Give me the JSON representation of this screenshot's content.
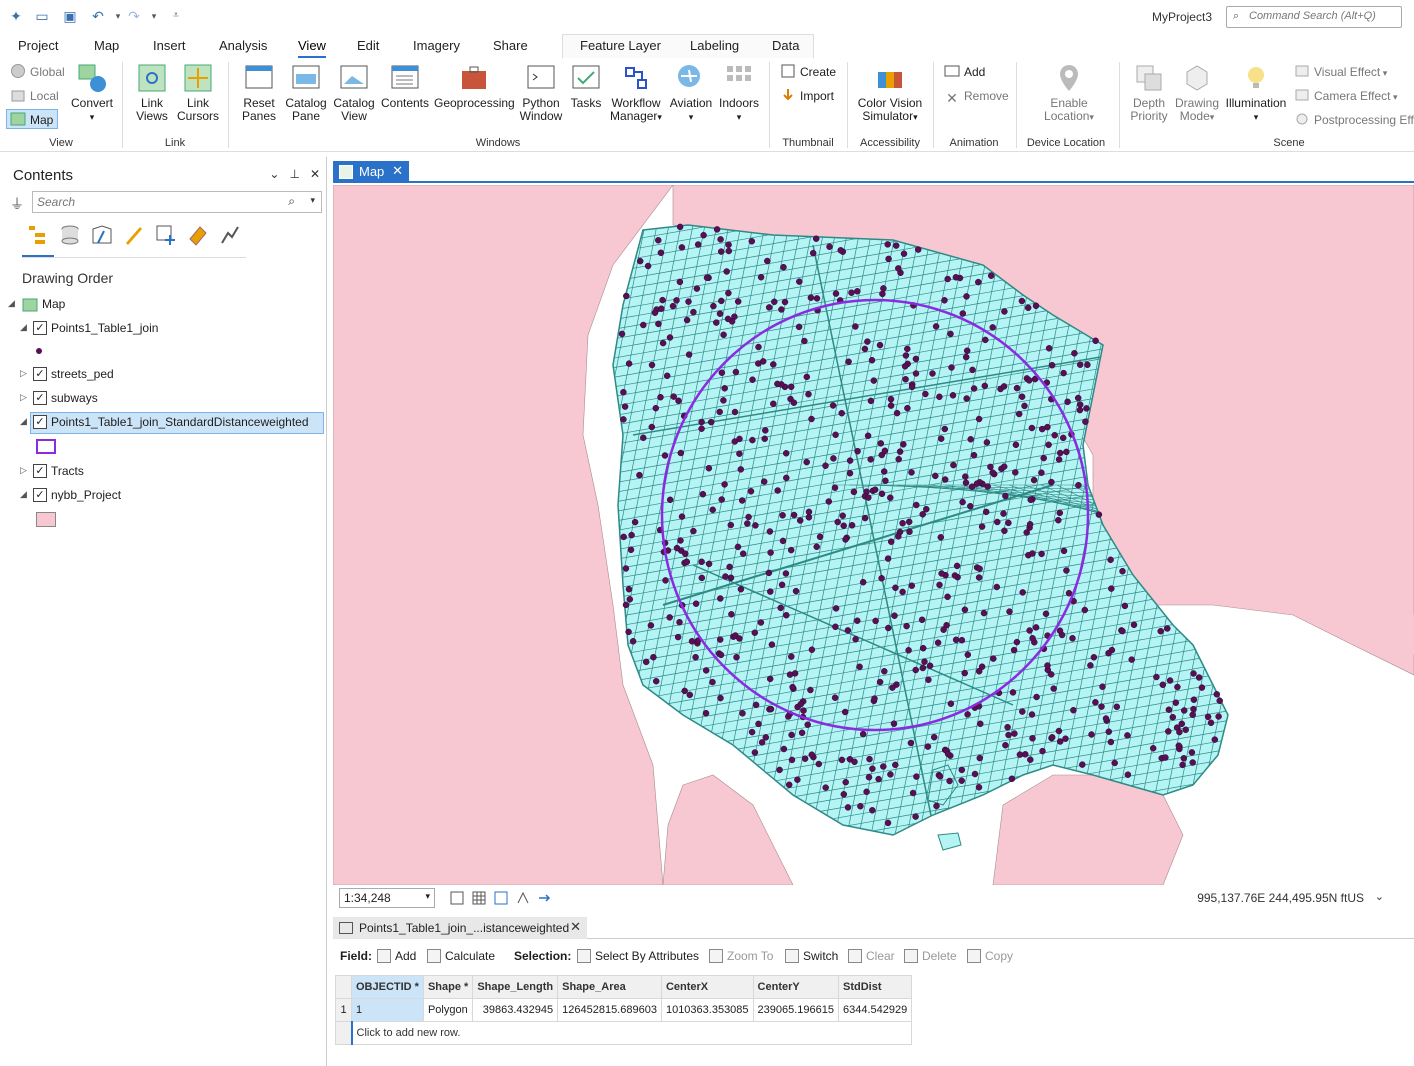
{
  "window": {
    "project_name": "MyProject3",
    "command_search_placeholder": "Command Search (Alt+Q)"
  },
  "ribbon_tabs": [
    "Project",
    "Map",
    "Insert",
    "Analysis",
    "View",
    "Edit",
    "Imagery",
    "Share"
  ],
  "active_tab": "View",
  "context_tabs": [
    "Feature Layer",
    "Labeling",
    "Data"
  ],
  "ribbon": {
    "view_group": {
      "label": "View",
      "global": "Global",
      "local": "Local",
      "map": "Map",
      "convert": "Convert"
    },
    "link_group": {
      "label": "Link",
      "link_views": "Link Views",
      "link_cursors": "Link Cursors"
    },
    "windows_group": {
      "label": "Windows",
      "buttons": [
        "Reset Panes",
        "Catalog Pane",
        "Catalog View",
        "Contents",
        "Geoprocessing",
        "Python Window",
        "Tasks",
        "Workflow Manager",
        "Aviation",
        "Indoors"
      ]
    },
    "thumbnail_group": {
      "label": "Thumbnail",
      "create": "Create",
      "import": "Import"
    },
    "accessibility_group": {
      "label": "Accessibility",
      "button": "Color Vision Simulator"
    },
    "animation_group": {
      "label": "Animation",
      "add": "Add",
      "remove": "Remove"
    },
    "device_location_group": {
      "label": "Device Location",
      "button": "Enable Location"
    },
    "scene_group": {
      "label": "Scene",
      "depth_priority": "Depth Priority",
      "drawing_mode": "Drawing Mode",
      "illumination": "Illumination",
      "visual_effect": "Visual Effect",
      "camera_effect": "Camera Effect",
      "postprocessing": "Postprocessing Effe"
    }
  },
  "contents": {
    "title": "Contents",
    "search_placeholder": "Search",
    "section": "Drawing Order",
    "layers": [
      {
        "name": "Map",
        "checked": false
      },
      {
        "name": "Points1_Table1_join",
        "checked": true
      },
      {
        "name": "streets_ped",
        "checked": true
      },
      {
        "name": "subways",
        "checked": true
      },
      {
        "name": "Points1_Table1_join_StandardDistanceweighted",
        "checked": true,
        "selected": true
      },
      {
        "name": "Tracts",
        "checked": true
      },
      {
        "name": "nybb_Project",
        "checked": true
      }
    ]
  },
  "map_view": {
    "tab_label": "Map",
    "scale": "1:34,248",
    "coordinates": "995,137.76E 244,495.95N ftUS",
    "colors": {
      "land_outside": "#f8c8d2",
      "borough_fill": "#b4f4f4",
      "streets": "#2e8a86",
      "points": "#5a0e57",
      "standard_distance_circle": "#8a2be2"
    }
  },
  "attribute_table": {
    "tab_label": "Points1_Table1_join_...istanceweighted",
    "toolbar": {
      "field_label": "Field:",
      "add": "Add",
      "calculate": "Calculate",
      "selection_label": "Selection:",
      "select_by_attributes": "Select By Attributes",
      "zoom_to": "Zoom To",
      "switch": "Switch",
      "clear": "Clear",
      "delete": "Delete",
      "copy": "Copy"
    },
    "columns": [
      "OBJECTID *",
      "Shape *",
      "Shape_Length",
      "Shape_Area",
      "CenterX",
      "CenterY",
      "StdDist"
    ],
    "rows": [
      [
        "1",
        "Polygon",
        "39863.432945",
        "126452815.689603",
        "1010363.353085",
        "239065.196615",
        "6344.542929"
      ]
    ],
    "add_row_text": "Click to add new row."
  }
}
